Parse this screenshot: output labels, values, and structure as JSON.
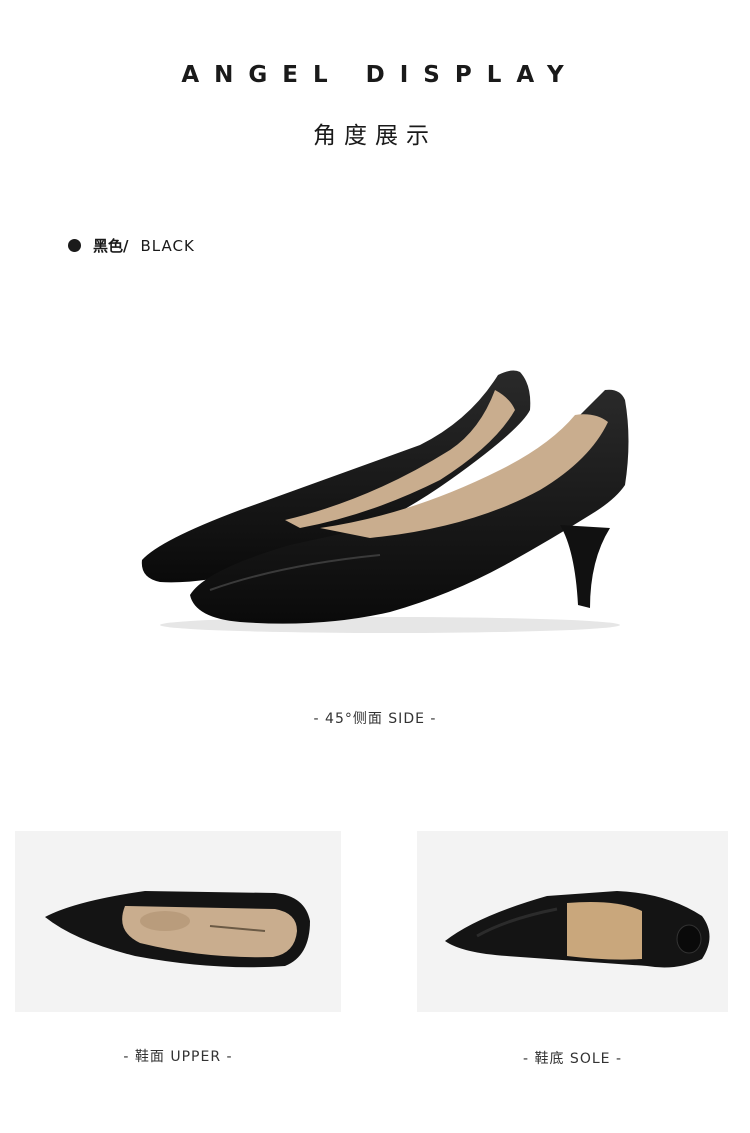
{
  "header": {
    "title_en": "ANGEL DISPLAY",
    "title_cn": "角度展示"
  },
  "color_option": {
    "label_cn": "黑色/",
    "label_en": "BLACK"
  },
  "views": {
    "side_caption": "- 45°侧面 SIDE -",
    "upper_caption": "- 鞋面 UPPER -",
    "sole_caption": "- 鞋底 SOLE -"
  },
  "colors": {
    "shoe_leather": "#141414",
    "lining": "#c9ad8e",
    "panel_bg": "#f3f3f3"
  }
}
